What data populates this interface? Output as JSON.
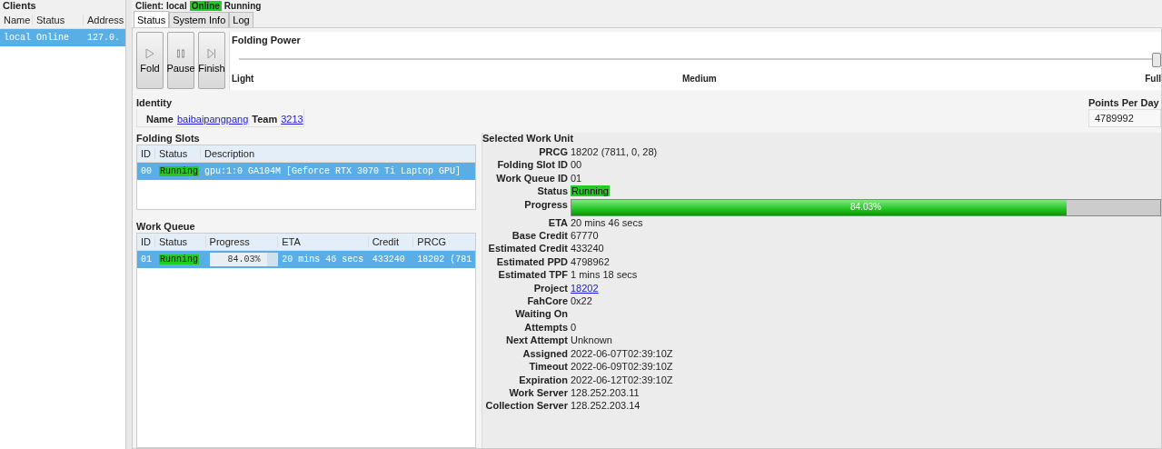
{
  "clients": {
    "title": "Clients",
    "columns": [
      "Name",
      "Status",
      "Address"
    ],
    "rows": [
      {
        "cells": [
          "local",
          "Online",
          "127.0."
        ],
        "selected": true
      }
    ]
  },
  "client_header": {
    "label": "Client: local",
    "status": "Online",
    "state": "Running"
  },
  "tabs": [
    {
      "label": "Status",
      "selected": true
    },
    {
      "label": "System Info",
      "selected": false
    },
    {
      "label": "Log",
      "selected": false
    }
  ],
  "controls": [
    {
      "label": "Fold",
      "kind": "play"
    },
    {
      "label": "Pause",
      "kind": "pause"
    },
    {
      "label": "Finish",
      "kind": "finish"
    }
  ],
  "folding_power": {
    "title": "Folding Power",
    "level": 1,
    "ticks": [
      "Light",
      "Medium",
      "Full"
    ]
  },
  "identity": {
    "title": "Identity",
    "name_label": "Name",
    "name": "baibaipangpang",
    "team_label": "Team",
    "team": "3213"
  },
  "points_per_day": {
    "title": "Points Per Day",
    "value": "4789992"
  },
  "folding_slots": {
    "title": "Folding Slots",
    "columns": [
      "ID",
      "Status",
      "Description"
    ],
    "rows": [
      {
        "id": "00",
        "status": "Running",
        "description": "gpu:1:0 GA104M [Geforce RTX 3070 Ti Laptop GPU]",
        "selected": true
      }
    ]
  },
  "work_queue": {
    "title": "Work Queue",
    "columns": [
      "ID",
      "Status",
      "Progress",
      "ETA",
      "Credit",
      "PRCG"
    ],
    "rows": [
      {
        "id": "01",
        "status": "Running",
        "progress": "84.03%",
        "level": 0.8403,
        "eta": "20 mins 46 secs",
        "credit": "433240",
        "prcg": "18202 (781",
        "selected": true
      }
    ]
  },
  "selected_work_unit": {
    "title": "Selected Work Unit",
    "fields": [
      {
        "label": "PRCG",
        "value": "18202 (7811, 0, 28)",
        "kind": "text"
      },
      {
        "label": "Folding Slot ID",
        "value": "00",
        "kind": "text"
      },
      {
        "label": "Work Queue ID",
        "value": "01",
        "kind": "text"
      },
      {
        "label": "Status",
        "value": "Running",
        "kind": "status"
      },
      {
        "label": "Progress",
        "value": "84.03%",
        "level": 0.8403,
        "kind": "progress"
      },
      {
        "label": "ETA",
        "value": "20 mins 46 secs",
        "kind": "text"
      },
      {
        "label": "Base Credit",
        "value": "67770",
        "kind": "text"
      },
      {
        "label": "Estimated Credit",
        "value": "433240",
        "kind": "text"
      },
      {
        "label": "Estimated PPD",
        "value": "4798962",
        "kind": "text"
      },
      {
        "label": "Estimated TPF",
        "value": "1 mins 18 secs",
        "kind": "text"
      },
      {
        "label": "Project",
        "value": "18202",
        "kind": "link"
      },
      {
        "label": "FahCore",
        "value": "0x22",
        "kind": "text"
      },
      {
        "label": "Waiting On",
        "kind": "text"
      },
      {
        "label": "Attempts",
        "value": "0",
        "kind": "text"
      },
      {
        "label": "Next Attempt",
        "value": "Unknown",
        "kind": "text"
      },
      {
        "label": "Assigned",
        "value": "2022-06-07T02:39:10Z",
        "kind": "text"
      },
      {
        "label": "Timeout",
        "value": "2022-06-09T02:39:10Z",
        "kind": "text"
      },
      {
        "label": "Expiration",
        "value": "2022-06-12T02:39:10Z",
        "kind": "text"
      },
      {
        "label": "Work Server",
        "value": "128.252.203.11",
        "kind": "text"
      },
      {
        "label": "Collection Server",
        "value": "128.252.203.14",
        "kind": "text"
      }
    ]
  }
}
